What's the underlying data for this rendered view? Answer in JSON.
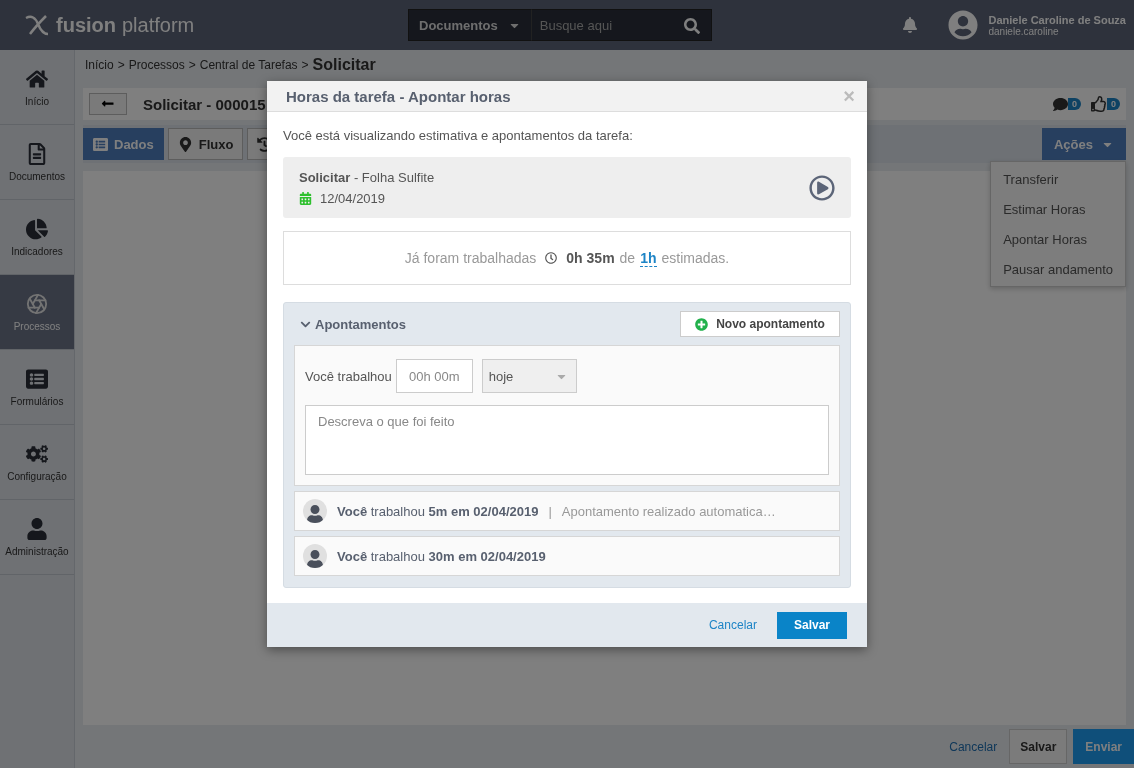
{
  "topbar": {
    "brand_bold": "fusion",
    "brand_light": "platform",
    "search_scope": "Documentos",
    "search_placeholder": "Busque aqui",
    "user_name": "Daniele Caroline de Souza",
    "user_login": "daniele.caroline"
  },
  "sidebar": {
    "items": [
      {
        "kind": "home",
        "label": "Início",
        "selected": false
      },
      {
        "kind": "documents",
        "label": "Documentos",
        "selected": false
      },
      {
        "kind": "indicators",
        "label": "Indicadores",
        "selected": false
      },
      {
        "kind": "processes",
        "label": "Processos",
        "selected": true
      },
      {
        "kind": "forms",
        "label": "Formulários",
        "selected": false
      },
      {
        "kind": "settings",
        "label": "Configuração",
        "selected": false
      },
      {
        "kind": "admin",
        "label": "Administração",
        "selected": false
      }
    ]
  },
  "breadcrumb": {
    "items": [
      "Início",
      "Processos",
      "Central de Tarefas"
    ],
    "separator": ">",
    "current": "Solicitar"
  },
  "task_header": {
    "title": "Solicitar - 000015",
    "comments": "0",
    "likes": "0"
  },
  "tabs": [
    {
      "kind": "data",
      "label": "Dados",
      "selected": true
    },
    {
      "kind": "flow",
      "label": "Fluxo",
      "selected": false
    },
    {
      "kind": "history",
      "selected": false
    }
  ],
  "actions": {
    "label": "Ações",
    "expanded": true,
    "menu": [
      "Transferir",
      "Estimar Horas",
      "Apontar Horas",
      "Pausar andamento"
    ]
  },
  "page_footer": {
    "cancel": "Cancelar",
    "save": "Salvar",
    "send": "Enviar"
  },
  "modal": {
    "title": "Horas da tarefa - Apontar horas",
    "close": "×",
    "intro": "Você está visualizando estimativa e apontamentos da tarefa:",
    "task": {
      "name": "Solicitar",
      "detail": "- Folha Sulfite",
      "date": "12/04/2019"
    },
    "summary": {
      "prefix": "Já foram trabalhadas",
      "worked": "0h 35m",
      "of": "de",
      "estimate": "1h",
      "suffix": "estimadas."
    },
    "section": {
      "title": "Apontamentos",
      "expanded": true,
      "new_button": "Novo apontamento",
      "form": {
        "label": "Você trabalhou",
        "time_placeholder": "00h 00m",
        "day": "hoje",
        "description_placeholder": "Descreva o que foi feito"
      },
      "entries": [
        {
          "text": "**Você** trabalhou **5m em 02/04/2019**",
          "separator": "|",
          "note": "Apontamento realizado automatica…"
        },
        {
          "text": "**Você** trabalhou **30m em 02/04/2019**"
        }
      ]
    },
    "cancel": "Cancelar",
    "save": "Salvar"
  }
}
